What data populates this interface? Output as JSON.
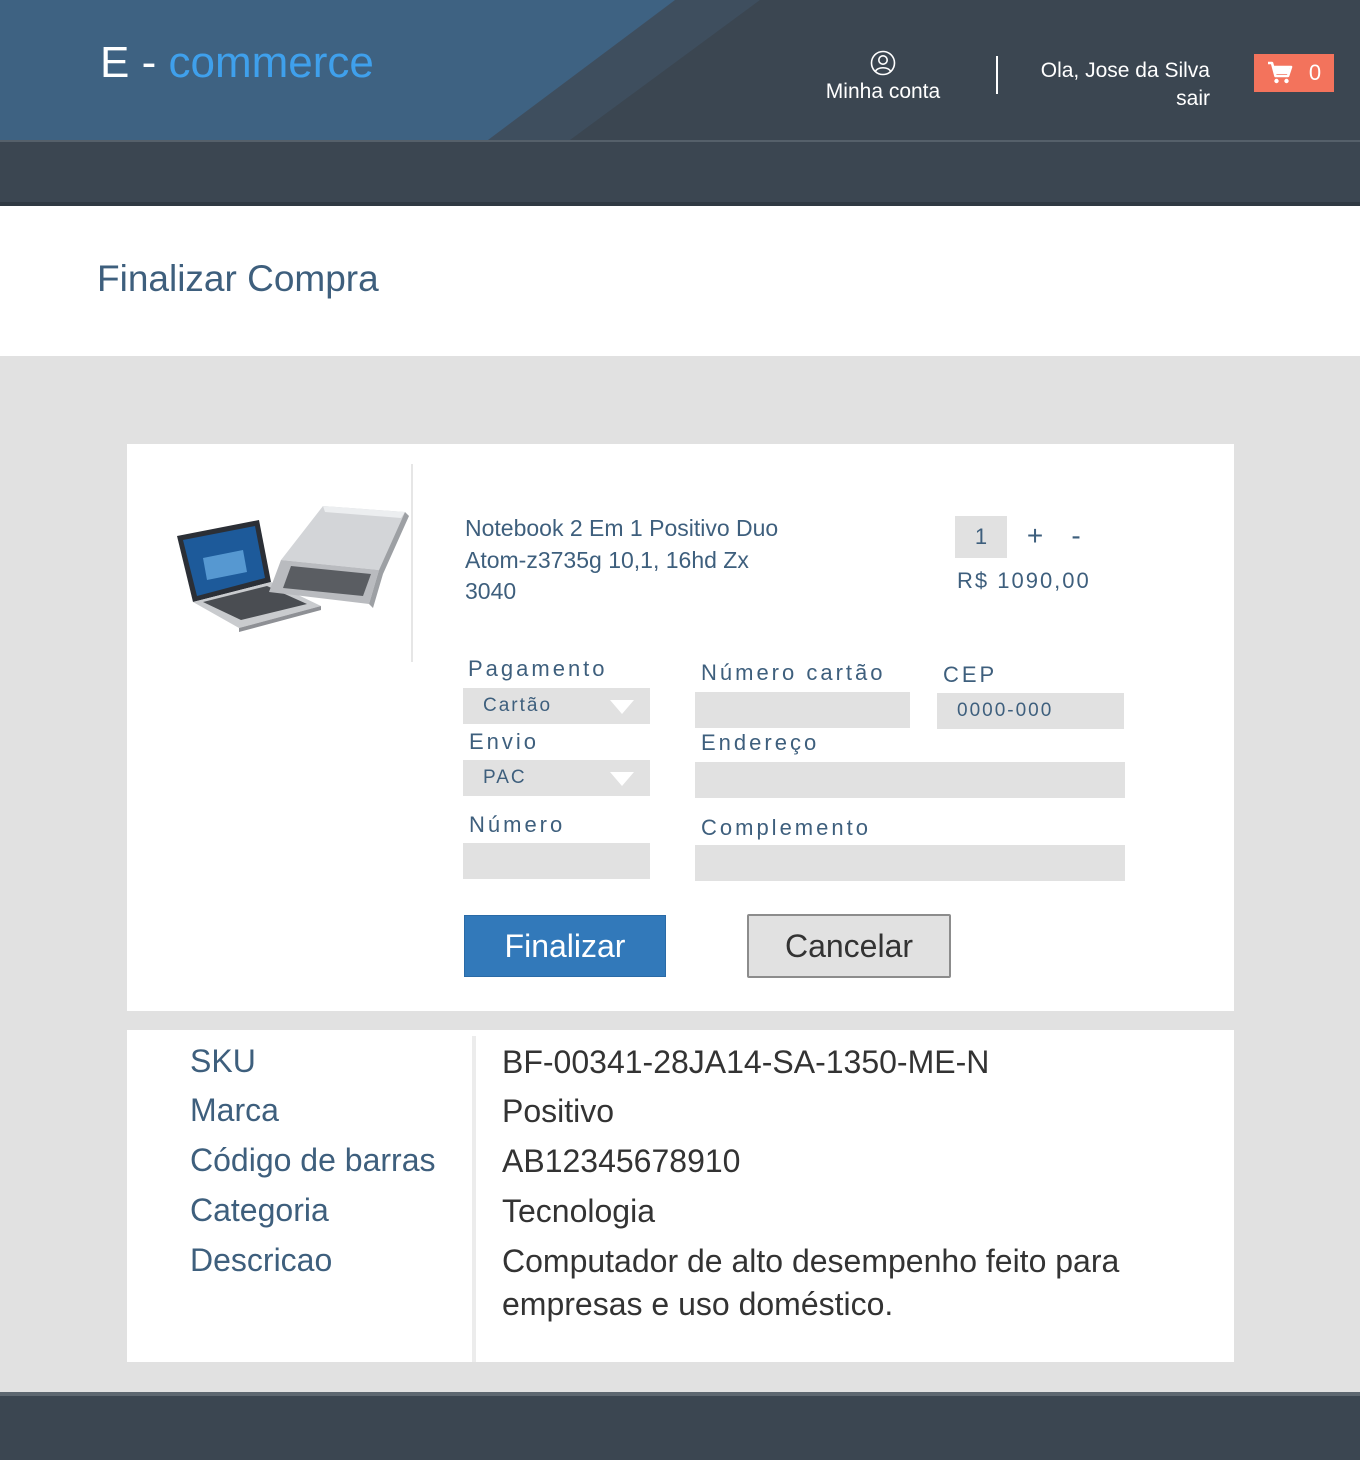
{
  "header": {
    "brand_prefix": "E -",
    "brand_suffix": "commerce",
    "account_label": "Minha conta",
    "greeting": "Ola, Jose da Silva",
    "logout": "sair",
    "cart_count": "0"
  },
  "page": {
    "title": "Finalizar Compra"
  },
  "product": {
    "name": "Notebook 2 Em 1 Positivo Duo Atom-z3735g 10,1, 16hd Zx 3040",
    "quantity": "1",
    "plus": "+",
    "minus": "-",
    "price": "R$ 1090,00"
  },
  "form": {
    "payment_label": "Pagamento",
    "payment_value": "Cartão",
    "shipping_label": "Envio",
    "shipping_value": "PAC",
    "number_label": "Número",
    "number_value": "",
    "card_label": "Número cartão",
    "card_value": "",
    "cep_label": "CEP",
    "cep_value": "0000-000",
    "address_label": "Endereço",
    "address_value": "",
    "complement_label": "Complemento",
    "complement_value": ""
  },
  "actions": {
    "finalize": "Finalizar",
    "cancel": "Cancelar"
  },
  "details": [
    {
      "label": "SKU",
      "value": "BF-00341-28JA14-SA-1350-ME-N"
    },
    {
      "label": "Marca",
      "value": "Positivo"
    },
    {
      "label": "Código de barras",
      "value": "AB12345678910"
    },
    {
      "label": "Categoria",
      "value": "Tecnologia"
    },
    {
      "label": "Descricao",
      "value": "Computador de alto desempenho feito para empresas e uso doméstico."
    }
  ],
  "colors": {
    "header_dark": "#3b4651",
    "header_blue": "#3e6282",
    "brand_accent": "#3fa0ec",
    "cart_badge": "#f3735c",
    "primary_button": "#3279ba",
    "label_text": "#3e5f7d",
    "field_bg": "#e1e1e1"
  },
  "icons": {
    "account": "user-circle-icon",
    "cart": "shopping-cart-icon",
    "select": "chevron-down-icon"
  }
}
